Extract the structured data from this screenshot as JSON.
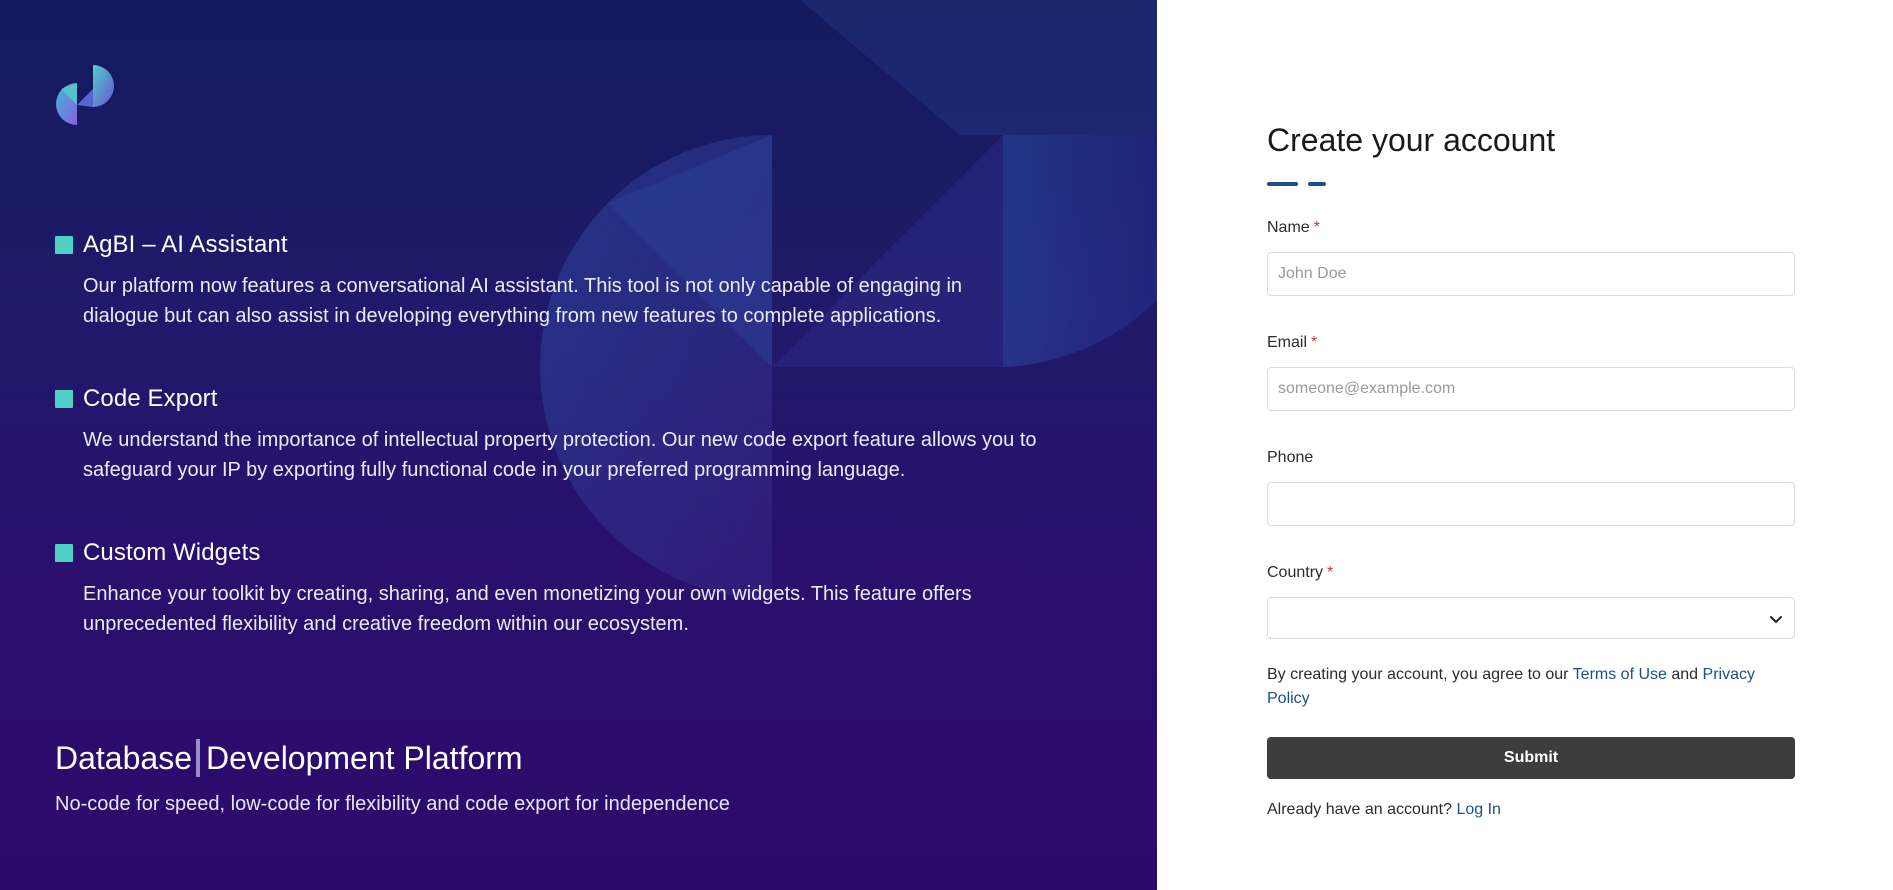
{
  "left": {
    "features": [
      {
        "title": "AgBI – AI Assistant",
        "text": "Our platform now features a conversational AI assistant. This tool is not only capable of engaging in dialogue but can also assist in developing everything from new features to complete applications."
      },
      {
        "title": "Code Export",
        "text": "We understand the importance of intellectual property protection. Our new code export feature allows you to safeguard your IP by exporting fully functional code in your preferred programming language."
      },
      {
        "title": "Custom Widgets",
        "text": "Enhance your toolkit by creating, sharing, and even monetizing your own widgets. This feature offers unprecedented flexibility and creative freedom within our ecosystem."
      }
    ],
    "platform_word": "Database",
    "platform_rest": "Development Platform",
    "platform_sub": "No-code for speed, low-code for flexibility and code export for independence"
  },
  "form": {
    "title": "Create your account",
    "required_mark": "*",
    "name_label": "Name",
    "name_placeholder": "John Doe",
    "email_label": "Email",
    "email_placeholder": "someone@example.com",
    "phone_label": "Phone",
    "country_label": "Country",
    "terms_prefix": "By creating your account, you agree to our",
    "terms_link": "Terms of Use",
    "terms_and": "and",
    "privacy_link": "Privacy Policy",
    "submit_label": "Submit",
    "login_prefix": "Already have an account?",
    "login_link": "Log In"
  },
  "colors": {
    "accent": "#1c4f8a",
    "bullet": "#4fd1c5",
    "submit_bg": "#3d3d3d",
    "required": "#d32f2f"
  },
  "icons": [
    "brand-logo-icon",
    "chevron-down-icon"
  ]
}
